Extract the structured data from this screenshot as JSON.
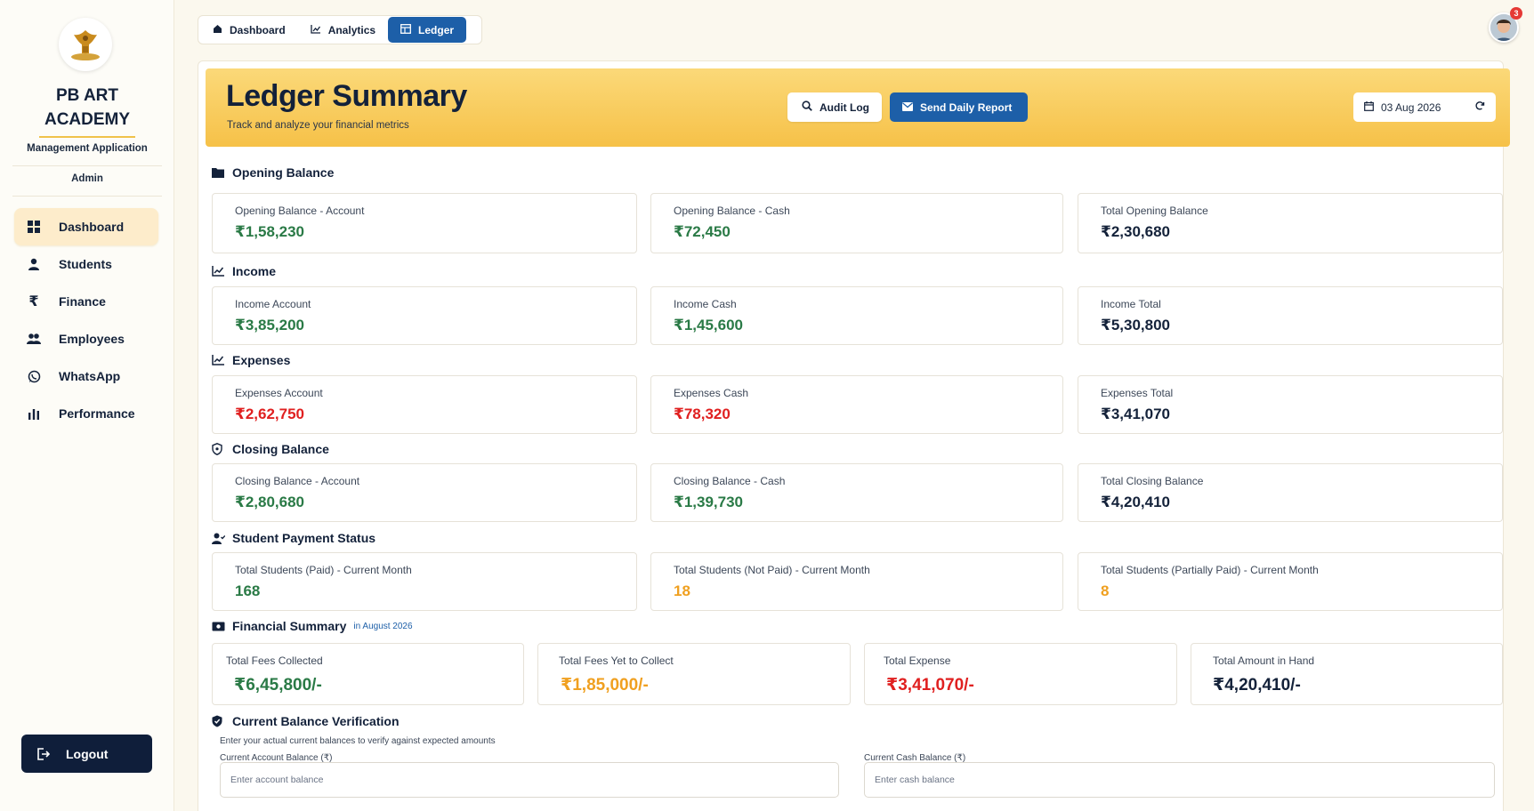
{
  "sidebar": {
    "brand": "PB ART ACADEMY",
    "subtitle": "Management Application",
    "role": "Admin",
    "items": [
      {
        "label": "Dashboard",
        "icon": "dashboard-icon"
      },
      {
        "label": "Students",
        "icon": "user-icon"
      },
      {
        "label": "Finance",
        "icon": "rupee-icon"
      },
      {
        "label": "Employees",
        "icon": "users-icon"
      },
      {
        "label": "WhatsApp",
        "icon": "whatsapp-icon"
      },
      {
        "label": "Performance",
        "icon": "bar-chart-icon"
      }
    ],
    "logout": "Logout"
  },
  "tabs": [
    {
      "label": "Dashboard",
      "icon": "home-icon"
    },
    {
      "label": "Analytics",
      "icon": "line-chart-icon"
    },
    {
      "label": "Ledger",
      "icon": "ledger-icon"
    }
  ],
  "notifications": {
    "count": "3"
  },
  "header": {
    "title": "Ledger Summary",
    "subtitle": "Track and analyze your financial metrics",
    "audit_label": "Audit Log",
    "send_label": "Send Daily Report",
    "date": "03 Aug 2026"
  },
  "opening": {
    "title": "Opening Balance",
    "cards": [
      {
        "label": "Opening Balance - Account",
        "value": "₹1,58,230"
      },
      {
        "label": "Opening Balance - Cash",
        "value": "₹72,450"
      },
      {
        "label": "Total Opening Balance",
        "value": "₹2,30,680"
      }
    ]
  },
  "income": {
    "title": "Income",
    "cards": [
      {
        "label": "Income Account",
        "value": "₹3,85,200"
      },
      {
        "label": "Income Cash",
        "value": "₹1,45,600"
      },
      {
        "label": "Income Total",
        "value": "₹5,30,800"
      }
    ]
  },
  "expenses": {
    "title": "Expenses",
    "cards": [
      {
        "label": "Expenses Account",
        "value": "₹2,62,750"
      },
      {
        "label": "Expenses Cash",
        "value": "₹78,320"
      },
      {
        "label": "Expenses Total",
        "value": "₹3,41,070"
      }
    ]
  },
  "closing": {
    "title": "Closing Balance",
    "cards": [
      {
        "label": "Closing Balance - Account",
        "value": "₹2,80,680"
      },
      {
        "label": "Closing Balance - Cash",
        "value": "₹1,39,730"
      },
      {
        "label": "Total Closing Balance",
        "value": "₹4,20,410"
      }
    ]
  },
  "students": {
    "title": "Student Payment Status",
    "cards": [
      {
        "label": "Total Students (Paid) - Current Month",
        "value": "168"
      },
      {
        "label": "Total Students (Not Paid) - Current Month",
        "value": "18"
      },
      {
        "label": "Total Students (Partially Paid) - Current Month",
        "value": "8"
      }
    ]
  },
  "financial": {
    "title": "Financial Summary",
    "note": "in August 2026",
    "cards": [
      {
        "label": "Total Fees Collected",
        "value": "₹6,45,800/-"
      },
      {
        "label": "Total Fees Yet to Collect",
        "value": "₹1,85,000/-"
      },
      {
        "label": "Total Expense",
        "value": "₹3,41,070/-"
      },
      {
        "label": "Total Amount in Hand",
        "value": "₹4,20,410/-"
      }
    ]
  },
  "verification": {
    "title": "Current Balance Verification",
    "subtitle": "Enter your actual current balances to verify against expected amounts",
    "account_label": "Current Account Balance (₹)",
    "account_placeholder": "Enter account balance",
    "cash_label": "Current Cash Balance (₹)",
    "cash_placeholder": "Enter cash balance"
  },
  "colors": {
    "accent": "#1d5fa8",
    "hero": "#f6c148",
    "positive": "#2a7a46",
    "negative": "#e02020",
    "warning": "#f0a020",
    "navy": "#0f1e3a"
  }
}
